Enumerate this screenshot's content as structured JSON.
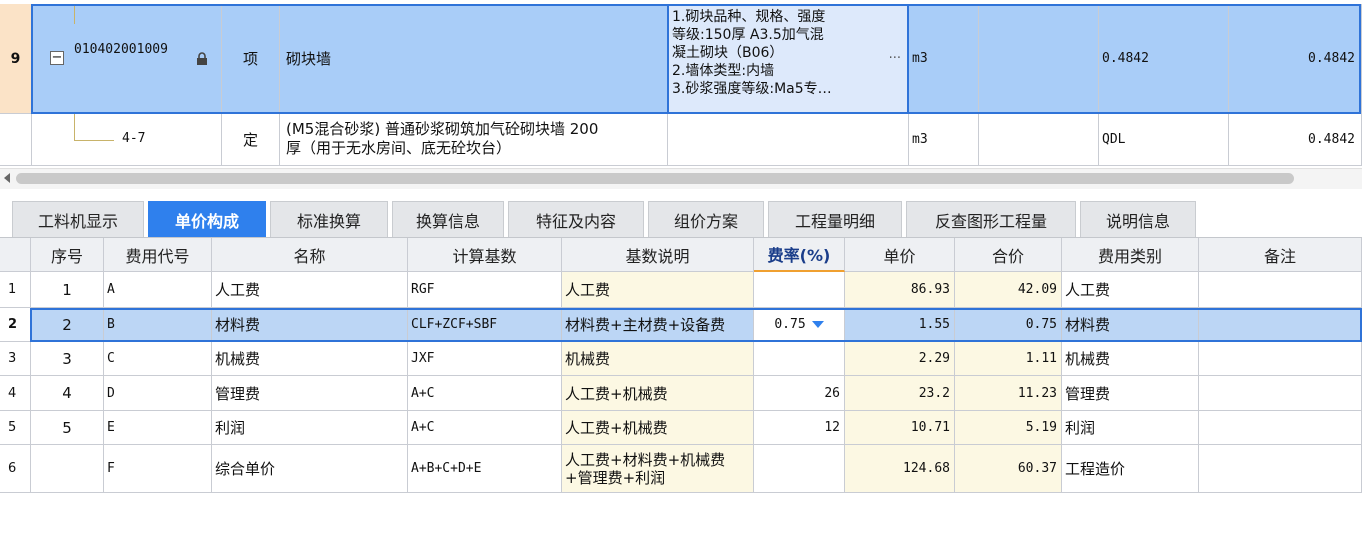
{
  "upper_rows": [
    {
      "row_no": "9",
      "expand_symbol": "−",
      "code": "010402001009",
      "lock_icon": "lock-icon",
      "type": "项",
      "name": "砌块墙",
      "features": [
        "1.砌块品种、规格、强度",
        "等级:150厚 A3.5加气混",
        "凝土砌块（B06）",
        "2.墙体类型:内墙",
        "3.砂浆强度等级:Ma5专…"
      ],
      "more": "···",
      "unit": "m3",
      "expr": "0.4842",
      "qty": "0.4842"
    },
    {
      "code": "4-7",
      "type": "定",
      "name_lines": [
        "(M5混合砂浆) 普通砂浆砌筑加气砼砌块墙 200",
        "厚（用于无水房间、底无砼坎台）"
      ],
      "unit": "m3",
      "expr": "QDL",
      "qty": "0.4842"
    }
  ],
  "tabs": [
    "工料机显示",
    "单价构成",
    "标准换算",
    "换算信息",
    "特征及内容",
    "组价方案",
    "工程量明细",
    "反查图形工程量",
    "说明信息"
  ],
  "active_tab": "单价构成",
  "table": {
    "headers": [
      "序号",
      "费用代号",
      "名称",
      "计算基数",
      "基数说明",
      "费率(%)",
      "单价",
      "合价",
      "费用类别",
      "备注"
    ],
    "rows": [
      {
        "row": "1",
        "seq": "1",
        "code": "A",
        "name": "人工费",
        "base": "RGF",
        "desc": "人工费",
        "rate": "",
        "price": "86.93",
        "total": "42.09",
        "category": "人工费",
        "note": ""
      },
      {
        "row": "2",
        "seq": "2",
        "code": "B",
        "name": "材料费",
        "base": "CLF+ZCF+SBF",
        "desc": "材料费+主材费+设备费",
        "rate": "0.75",
        "price": "1.55",
        "total": "0.75",
        "category": "材料费",
        "note": ""
      },
      {
        "row": "3",
        "seq": "3",
        "code": "C",
        "name": "机械费",
        "base": "JXF",
        "desc": "机械费",
        "rate": "",
        "price": "2.29",
        "total": "1.11",
        "category": "机械费",
        "note": ""
      },
      {
        "row": "4",
        "seq": "4",
        "code": "D",
        "name": "管理费",
        "base": "A+C",
        "desc": "人工费+机械费",
        "rate": "26",
        "price": "23.2",
        "total": "11.23",
        "category": "管理费",
        "note": ""
      },
      {
        "row": "5",
        "seq": "5",
        "code": "E",
        "name": "利润",
        "base": "A+C",
        "desc": "人工费+机械费",
        "rate": "12",
        "price": "10.71",
        "total": "5.19",
        "category": "利润",
        "note": ""
      },
      {
        "row": "6",
        "seq": "",
        "code": "F",
        "name": "综合单价",
        "base": "A+B+C+D+E",
        "desc_lines": [
          "人工费+材料费+机械费",
          "+管理费+利润"
        ],
        "rate": "",
        "price": "124.68",
        "total": "60.37",
        "category": "工程造价",
        "note": ""
      }
    ],
    "selected_row": "2"
  },
  "colors": {
    "selection_blue": "#2f73d8",
    "selected_row_fill": "#a9cdf8",
    "active_tab": "#2f80ed",
    "yellow_cells": "#fcf8e3"
  }
}
